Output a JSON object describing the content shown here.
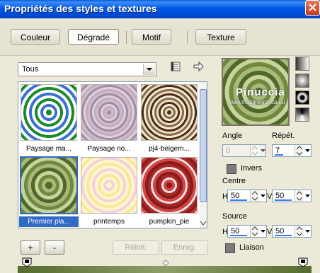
{
  "window": {
    "title": "Propriétés des styles et textures"
  },
  "tabs": [
    {
      "label": "Couleur"
    },
    {
      "label": "Dégradé"
    },
    {
      "label": "Motif"
    },
    {
      "label": "Texture"
    }
  ],
  "filter": {
    "selected": "Tous"
  },
  "gradients": [
    {
      "name": "Paysage ma...",
      "colors": [
        "#1a8a2a",
        "#ffffff",
        "#3b6fd6",
        "#ffffff"
      ]
    },
    {
      "name": "Paysage no...",
      "colors": [
        "#9b8fa8",
        "#d6b8c8",
        "#bfaec0",
        "#e0d0da"
      ]
    },
    {
      "name": "pj4-beigem...",
      "colors": [
        "#4a2e16",
        "#e9dcc0",
        "#8a6a48",
        "#f2ead8"
      ]
    },
    {
      "name": "Premier pla...",
      "colors": [
        "#4d6a28",
        "#a9b97a",
        "#6f8a3e",
        "#c8d39e"
      ]
    },
    {
      "name": "printemps",
      "colors": [
        "#fff7c8",
        "#f4d0e0",
        "#fff7c8",
        "#f7e7a0"
      ]
    },
    {
      "name": "pumpkin_pie",
      "colors": [
        "#8b1a1a",
        "#d04545",
        "#f0e0e0",
        "#a82828"
      ]
    }
  ],
  "buttons": {
    "add": "+",
    "remove": "-",
    "reset": "Réinit.",
    "save": "Enreg."
  },
  "preview": {
    "watermark": "Pinuccia",
    "watermark_url": "www.maidiregrafica.eu"
  },
  "settings": {
    "angle_label": "Angle",
    "angle_value": "0",
    "repeat_label": "Répét.",
    "repeat_value": "7",
    "invert_label": "Invers",
    "center_label": "Centre",
    "center_h": "50",
    "center_v": "50",
    "source_label": "Source",
    "source_h": "50",
    "source_v": "50",
    "link_label": "Liaison",
    "h_label": "H",
    "v_label": "V"
  },
  "colors": {
    "accent": "#316ac5",
    "titlebar": "#0058e6"
  }
}
